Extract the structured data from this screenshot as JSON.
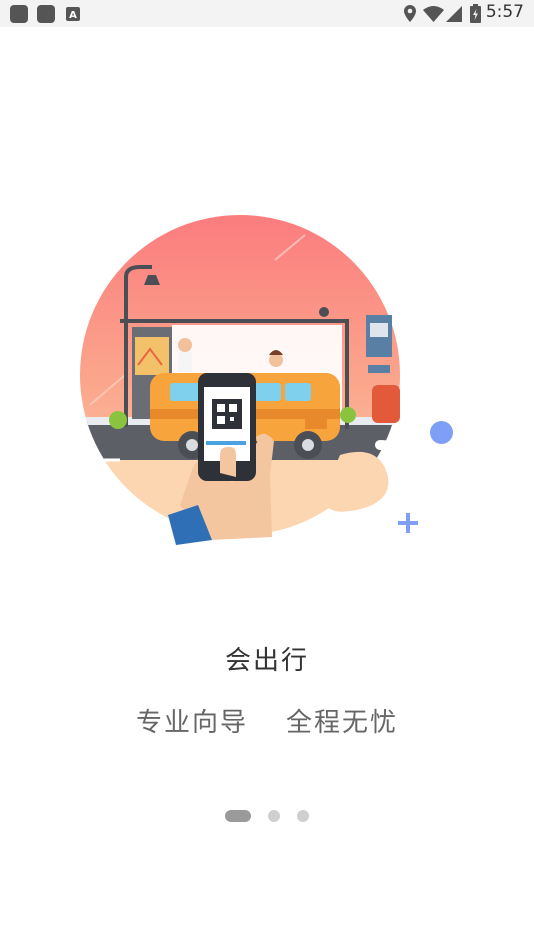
{
  "status_bar": {
    "time": "5:57",
    "icons": [
      "app-icon",
      "app-icon",
      "keyboard-icon",
      "location-icon",
      "wifi-icon",
      "signal-icon",
      "battery-icon"
    ]
  },
  "onboarding": {
    "title": "会出行",
    "subtitle_left": "专业向导",
    "subtitle_right": "全程无忧"
  },
  "pager": {
    "count": 3,
    "active_index": 0
  },
  "colors": {
    "accent_blue": "#7f9ef5",
    "sky_gradient_top": "#fb7f7f",
    "sky_gradient_bottom": "#fbd0a8",
    "bus_orange": "#f7a43c"
  }
}
